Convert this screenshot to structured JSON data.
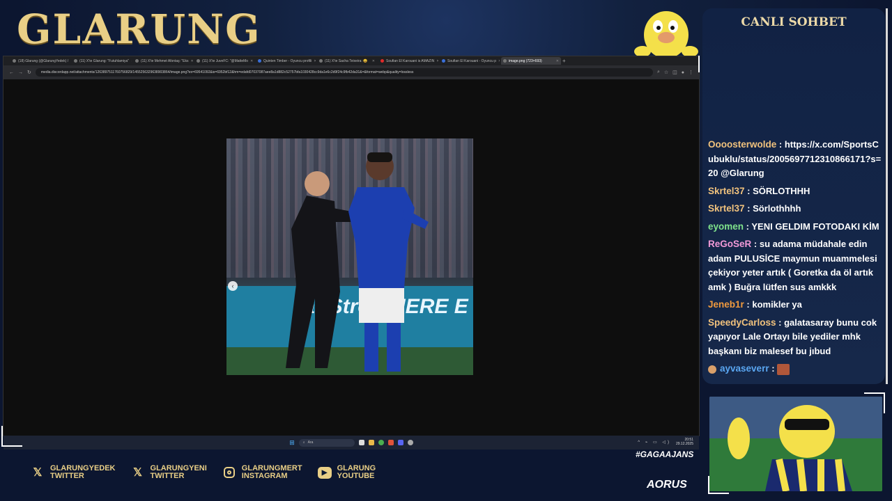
{
  "overlay": {
    "logo": "GLARUNG",
    "hashtag": "#GAGAAJANS",
    "sponsor": "AORUS"
  },
  "browser": {
    "tabs": [
      {
        "label": "(18) Glarung (@GlarungYedek) /",
        "active": false
      },
      {
        "label": "(11) X'te Glarung: \"Futuhlamiya\"",
        "active": false
      },
      {
        "label": "(11) X'te Mehmet Altıntaş: \"Eks",
        "active": false
      },
      {
        "label": "(11) X'te JuveFC: \"@MatteMo",
        "active": false
      },
      {
        "label": "Quinten Timber - Oyuncu profili",
        "active": false
      },
      {
        "label": "(11) X'te Sacha Teixeira: 😀",
        "active": false
      },
      {
        "label": "Soufian El Karouani is AMAZIN",
        "active": false
      },
      {
        "label": "Soufian El Karouani - Oyuncu p",
        "active": false
      },
      {
        "label": "image.png (723×693)",
        "active": true
      }
    ],
    "new_tab": "+",
    "url": "media.discordapp.net/attachments/1263897511760756829/1455256329638903864/image.png?ex=69541092&is=6952bf12&hm=edafd07037087aee8a1d882c52757bfa1030428cc9da1e6c2d9f24c9fb42da31&=&format=webp&quality=lossless",
    "photo_board_text": "ar Stre  CHERE E"
  },
  "taskbar": {
    "search_placeholder": "Ara",
    "time": "20:51",
    "date": "29.12.2025"
  },
  "chat": {
    "title": "CANLI SOHBET",
    "messages": [
      {
        "user": "Oooosterwolde",
        "color": "#f1c27d",
        "text": "https://x.com/SportsCubuklu/status/2005697712310866171?s=20 @Glarung"
      },
      {
        "user": "Skrtel37",
        "color": "#f1c27d",
        "text": "SÖRLOTHHH"
      },
      {
        "user": "Skrtel37",
        "color": "#f1c27d",
        "text": "Sörlothhhh"
      },
      {
        "user": "eyomen",
        "color": "#7fe38b",
        "text": "YENI GELDIM FOTODAKI KİM"
      },
      {
        "user": "ReGoSeR",
        "color": "#f29ad8",
        "text": "su adama müdahale edin adam PULUSİCE maymun muammelesi çekiyor yeter artık ( Goretka da öl artık amk ) Buğra lütfen sus amkkk"
      },
      {
        "user": "Jeneb1r",
        "color": "#f09a3e",
        "text": "komikler ya"
      },
      {
        "user": "SpeedyCarloss",
        "color": "#f1c27d",
        "text": "galatasaray bunu cok yapıyor Lale Ortayı bile yediler mhk başkanı biz malesef bu jıbud"
      },
      {
        "user": "ayvaseverr",
        "color": "#5aa7f2",
        "text": ""
      }
    ]
  },
  "socials": [
    {
      "handle": "GLARUNGYEDEK",
      "platform": "TWITTER",
      "icon": "x-icon"
    },
    {
      "handle": "GLARUNGYENI",
      "platform": "TWITTER",
      "icon": "x-icon"
    },
    {
      "handle": "GLARUNGMERT",
      "platform": "INSTAGRAM",
      "icon": "instagram-icon"
    },
    {
      "handle": "GLARUNG",
      "platform": "YOUTUBE",
      "icon": "youtube-icon"
    }
  ],
  "colors": {
    "gold": "#e9cf86",
    "background": "#0d1a33",
    "chat_bg": "#112244"
  }
}
